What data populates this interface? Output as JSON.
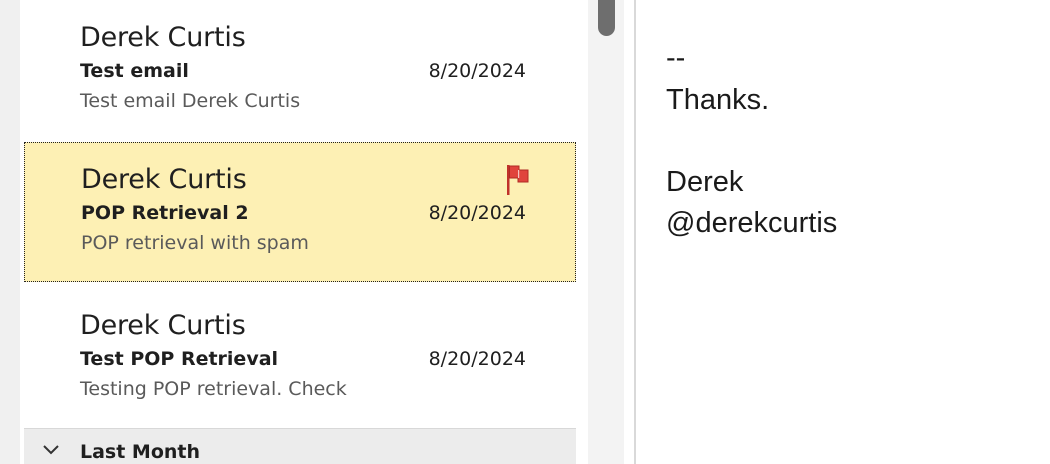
{
  "message_list": {
    "items": [
      {
        "sender": "Derek Curtis",
        "subject": "Test email",
        "date": "8/20/2024",
        "preview": "Test email  Derek Curtis",
        "flagged": false,
        "selected": false
      },
      {
        "sender": "Derek Curtis",
        "subject": "POP Retrieval 2",
        "date": "8/20/2024",
        "preview": "POP retrieval with spam",
        "flagged": true,
        "selected": true
      },
      {
        "sender": "Derek Curtis",
        "subject": "Test POP Retrieval",
        "date": "8/20/2024",
        "preview": "Testing POP retrieval. Check",
        "flagged": false,
        "selected": false
      }
    ],
    "group_header": {
      "label": "Last Month",
      "icon": "chevron-down-icon"
    }
  },
  "reading_pane": {
    "body_lines": [
      "--",
      "Thanks.",
      "",
      "Derek",
      "@derekcurtis"
    ]
  },
  "colors": {
    "selected_bg": "#fdf0b4",
    "flag": "#e0443c",
    "preview_text": "#5a5a5a"
  }
}
